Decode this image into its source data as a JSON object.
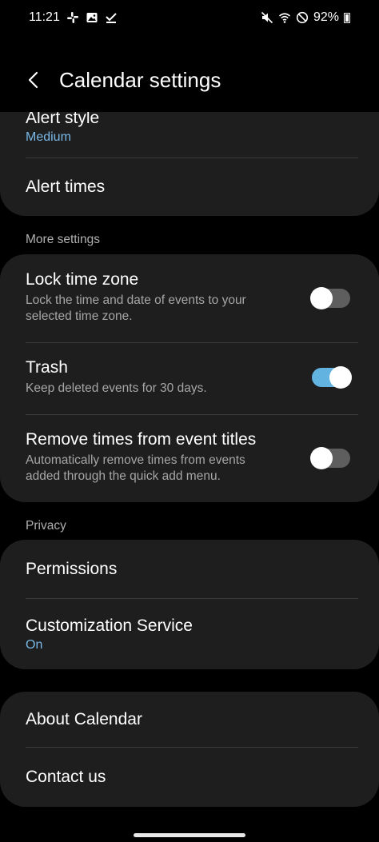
{
  "status_bar": {
    "time": "11:21",
    "battery": "92%",
    "left_icons": [
      "slack-icon",
      "gallery-icon",
      "check-icon"
    ],
    "right_icons": [
      "mute-icon",
      "wifi-icon",
      "dnd-icon",
      "battery-icon"
    ]
  },
  "header": {
    "title": "Calendar settings"
  },
  "alerts_card": {
    "alert_style": {
      "title": "Alert style",
      "value": "Medium"
    },
    "alert_times": {
      "title": "Alert times"
    }
  },
  "more_settings": {
    "header": "More settings",
    "lock_time_zone": {
      "title": "Lock time zone",
      "subtitle_line1": "Lock the time and date of events to your",
      "subtitle_line2": "selected time zone.",
      "enabled": false
    },
    "trash": {
      "title": "Trash",
      "subtitle_line1": "Keep deleted events for 30 days.",
      "enabled": true
    },
    "remove_times": {
      "title": "Remove times from event titles",
      "subtitle_line1": "Automatically remove times from events",
      "subtitle_line2": "added through the quick add menu.",
      "enabled": false
    }
  },
  "privacy": {
    "header": "Privacy",
    "permissions": {
      "title": "Permissions"
    },
    "customization": {
      "title": "Customization Service",
      "value": "On"
    }
  },
  "about_card": {
    "about": {
      "title": "About Calendar"
    },
    "contact": {
      "title": "Contact us"
    }
  },
  "colors": {
    "background": "#000000",
    "card": "#1e1e1e",
    "accent": "#79b8e6",
    "toggle_on": "#62b3e0",
    "toggle_off": "#5e5e5e"
  }
}
